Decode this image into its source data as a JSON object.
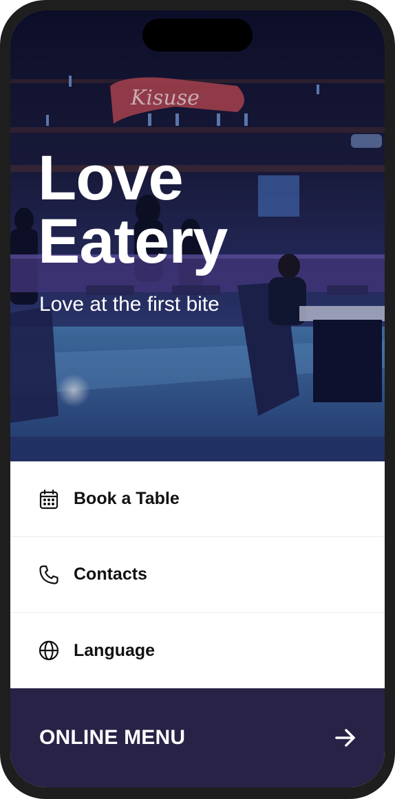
{
  "hero": {
    "title_line1": "Love",
    "title_line2": "Eatery",
    "subtitle": "Love at the first bite",
    "sign_text": "Kisuse"
  },
  "menu": {
    "items": [
      {
        "label": "Book a Table",
        "icon": "calendar-icon"
      },
      {
        "label": "Contacts",
        "icon": "phone-icon"
      },
      {
        "label": "Language",
        "icon": "globe-icon"
      }
    ]
  },
  "cta": {
    "label": "ONLINE MENU",
    "icon": "arrow-right-icon"
  },
  "colors": {
    "cta_background": "#272246",
    "hero_overlay": "#15183a",
    "text_dark": "#111111"
  }
}
